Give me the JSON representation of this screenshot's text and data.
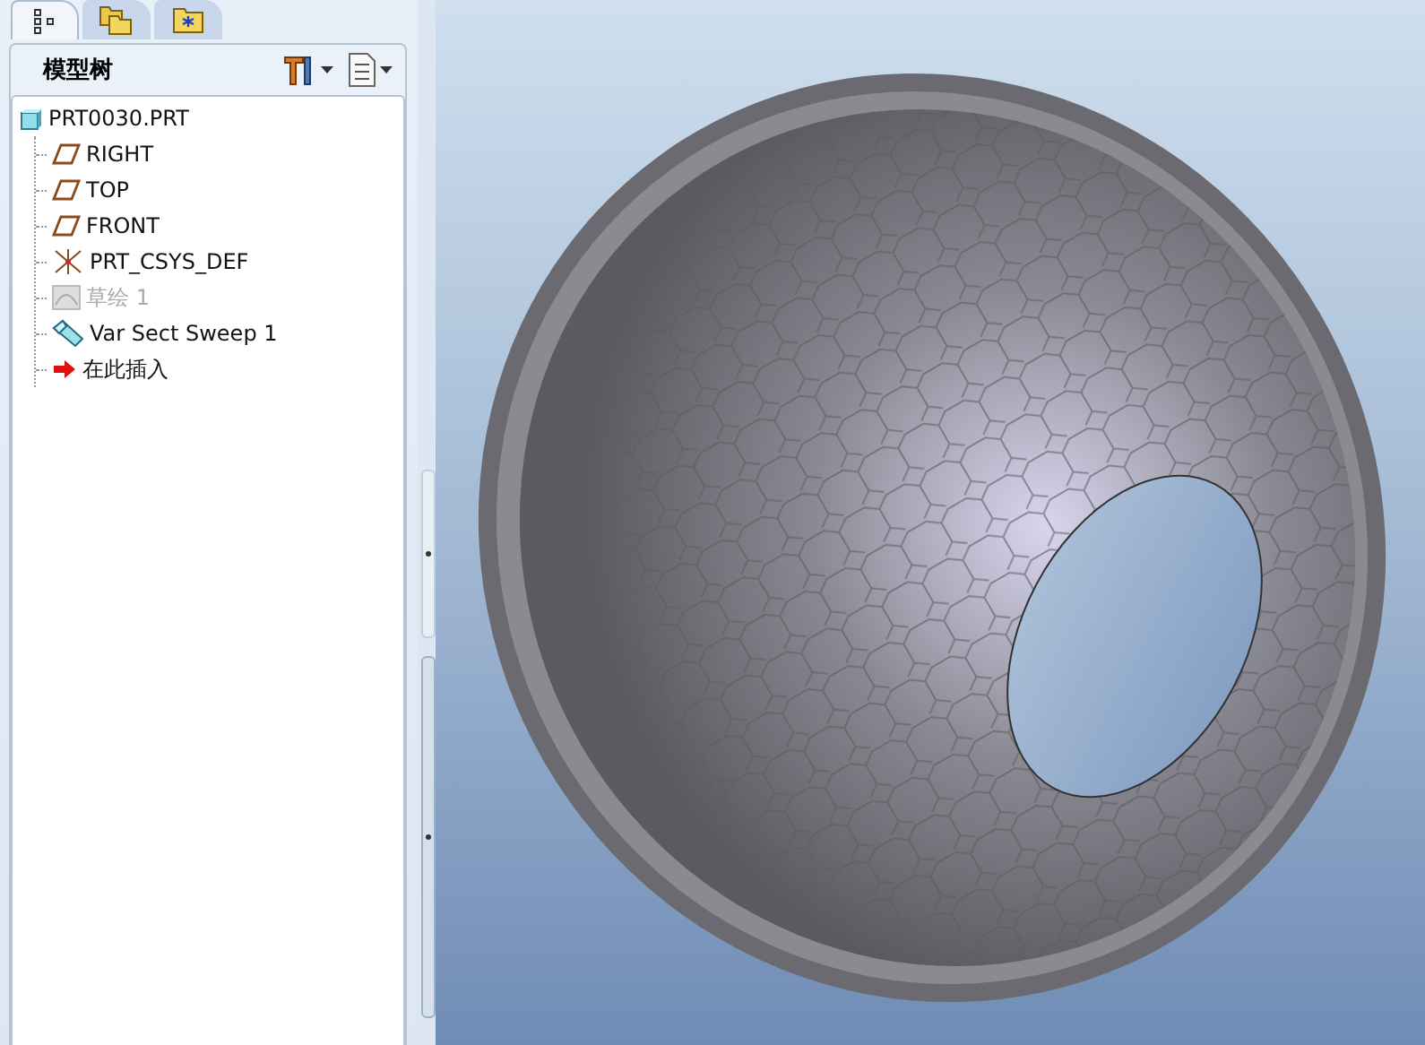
{
  "navigator_tabs": [
    {
      "kind": "tree",
      "selected": true
    },
    {
      "kind": "folders",
      "selected": false
    },
    {
      "kind": "favorites",
      "selected": false
    }
  ],
  "model_tree": {
    "title": "模型树",
    "root": {
      "label": "PRT0030.PRT",
      "kind": "part",
      "children": [
        {
          "label": "RIGHT",
          "kind": "plane",
          "disabled": false
        },
        {
          "label": "TOP",
          "kind": "plane",
          "disabled": false
        },
        {
          "label": "FRONT",
          "kind": "plane",
          "disabled": false
        },
        {
          "label": "PRT_CSYS_DEF",
          "kind": "csys",
          "disabled": false
        },
        {
          "label": "草绘 1",
          "kind": "sketch",
          "disabled": true
        },
        {
          "label": "Var Sect Sweep 1",
          "kind": "sweep",
          "disabled": false
        },
        {
          "label": "在此插入",
          "kind": "insert",
          "disabled": false
        }
      ]
    }
  }
}
